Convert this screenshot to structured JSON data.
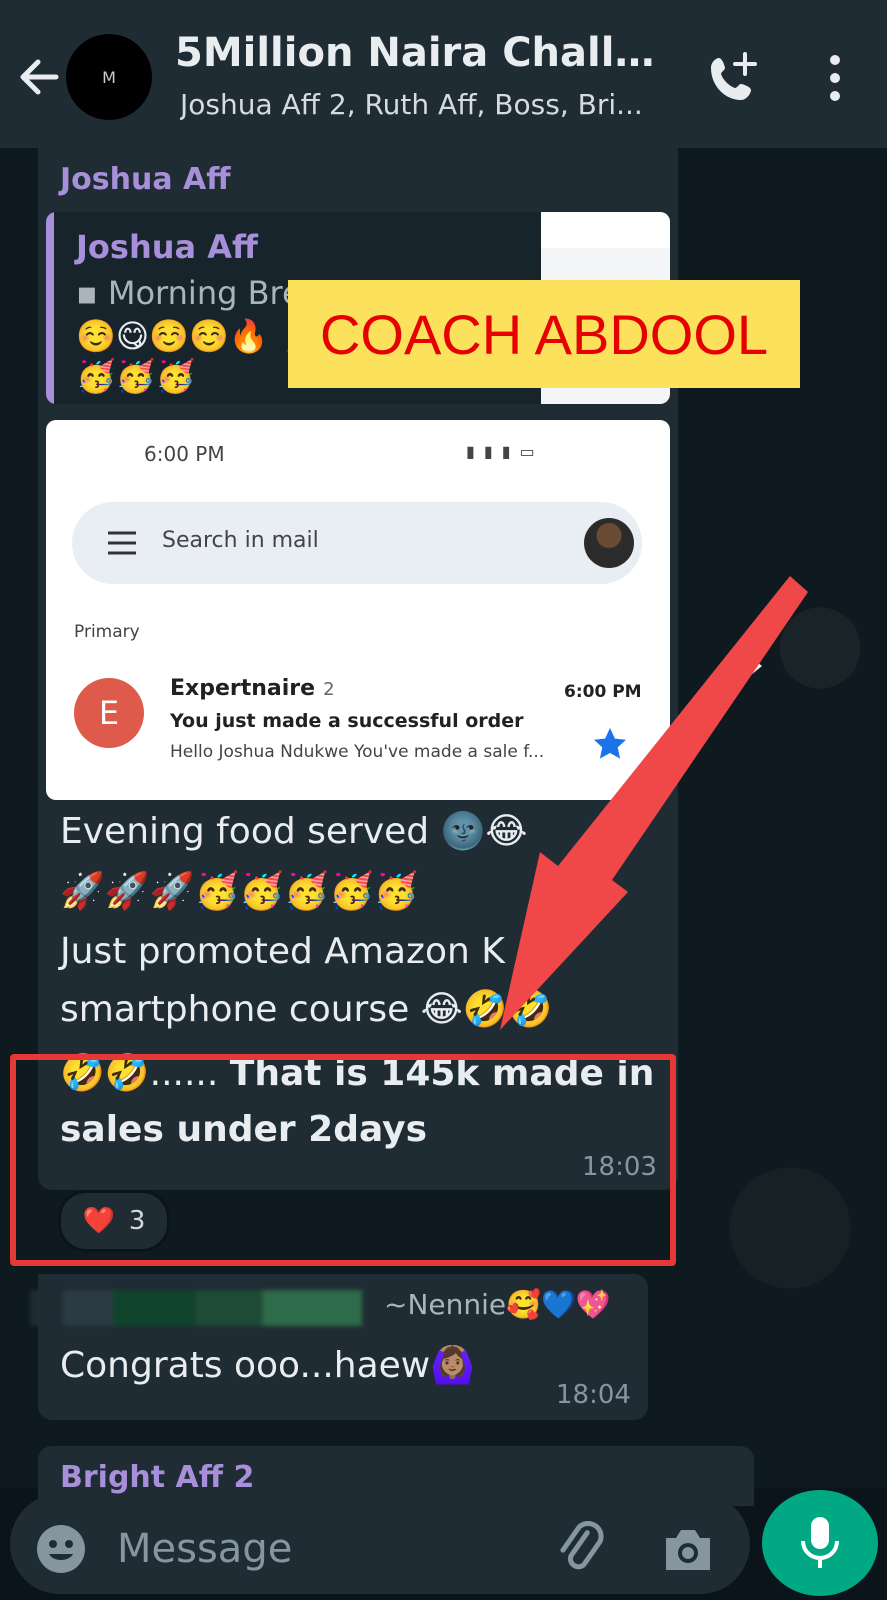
{
  "header": {
    "avatar_letter": "M",
    "title": "5Million Naira Challeng...",
    "subtitle": "Joshua Aff 2,  Ruth Aff, Boss, Bri..."
  },
  "message1": {
    "sender": "Joshua Aff",
    "quote": {
      "sender": "Joshua Aff",
      "text": "Morning Bre",
      "emoji": "☺️😋☺️☺️🔥 💃💃💃🥳🥳🥳🥳🥳🥳"
    },
    "screenshot": {
      "status_time": "6:00 PM",
      "search_placeholder": "Search in mail",
      "section": "Primary",
      "sender_initial": "E",
      "sender": "Expertnaire",
      "count": "2",
      "time": "6:00 PM",
      "subject": "You just made a successful order",
      "snippet": "Hello Joshua Ndukwe You've made a sale f..."
    },
    "lines": [
      "Evening food served 🌚😂",
      "🚀🚀🚀🥳🥳🥳🥳🥳",
      "Just promoted Amazon K",
      "smartphone course 😂🤣🤣"
    ],
    "highlight_prefix": "🤣🤣......",
    "highlight_bold_1": "That is 145k made in",
    "highlight_bold_2": "sales under 2days",
    "time": "18:03",
    "reaction": {
      "emoji": "❤️",
      "count": "3"
    }
  },
  "banner": {
    "text": "COACH ABDOOL"
  },
  "message2": {
    "sender_name": "~Nennie🥰💙💖",
    "text": "Congrats ooo...haew🙆🏽‍♀️",
    "time": "18:04"
  },
  "message3": {
    "sender": "Bright Aff 2"
  },
  "input": {
    "placeholder": "Message"
  },
  "colors": {
    "header_bg": "#1f2c34",
    "accent_green": "#00a884",
    "sender_purple": "#a88fd9",
    "highlight_red": "#e53935",
    "banner_yellow": "#fbe15c",
    "banner_text_red": "#e60000"
  },
  "icons": {
    "back": "arrow-left-icon",
    "call": "add-call-icon",
    "menu": "more-vertical-icon",
    "forward": "forward-icon",
    "emoji": "emoji-icon",
    "attach": "paperclip-icon",
    "camera": "camera-icon",
    "mic": "microphone-icon"
  }
}
